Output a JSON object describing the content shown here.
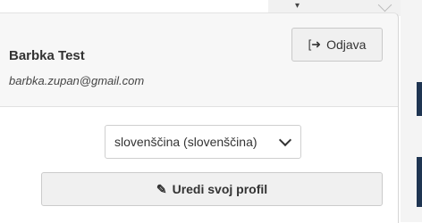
{
  "user": {
    "name": "Barbka Test",
    "email": "barbka.zupan@gmail.com"
  },
  "logout": {
    "icon": "sign-out-icon",
    "label": "Odjava"
  },
  "language": {
    "selected": "slovenščina (slovenščina)"
  },
  "edit_profile": {
    "icon": "edit-icon",
    "label": "Uredi svoj profil"
  },
  "colors": {
    "header_bg": "#f7f7f7",
    "button_bg": "#f0f0f0",
    "text": "#333333",
    "backdrop_accent": "#1f3552"
  }
}
